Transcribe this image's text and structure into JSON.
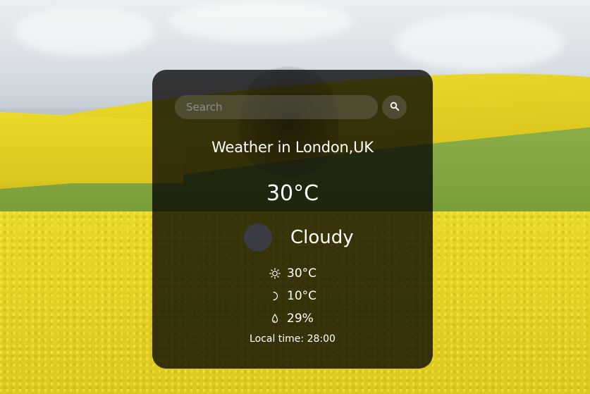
{
  "search": {
    "placeholder": "Search",
    "value": ""
  },
  "weather": {
    "title": "Weather in London,UK",
    "temperature": "30°C",
    "condition": "Cloudy",
    "high": "30°C",
    "low": "10°C",
    "humidity": "29%",
    "local_time": "Local time: 28:00"
  },
  "icons": {
    "search": "search-icon",
    "condition": "weather-condition-icon",
    "high": "sun-icon",
    "low": "moon-icon",
    "humidity": "droplet-icon"
  },
  "colors": {
    "card_background": "rgba(0,0,0,0.76)",
    "text": "#ffffff",
    "input_background": "rgba(125,125,125,0.35)",
    "condition_icon": "#3b3b44"
  }
}
